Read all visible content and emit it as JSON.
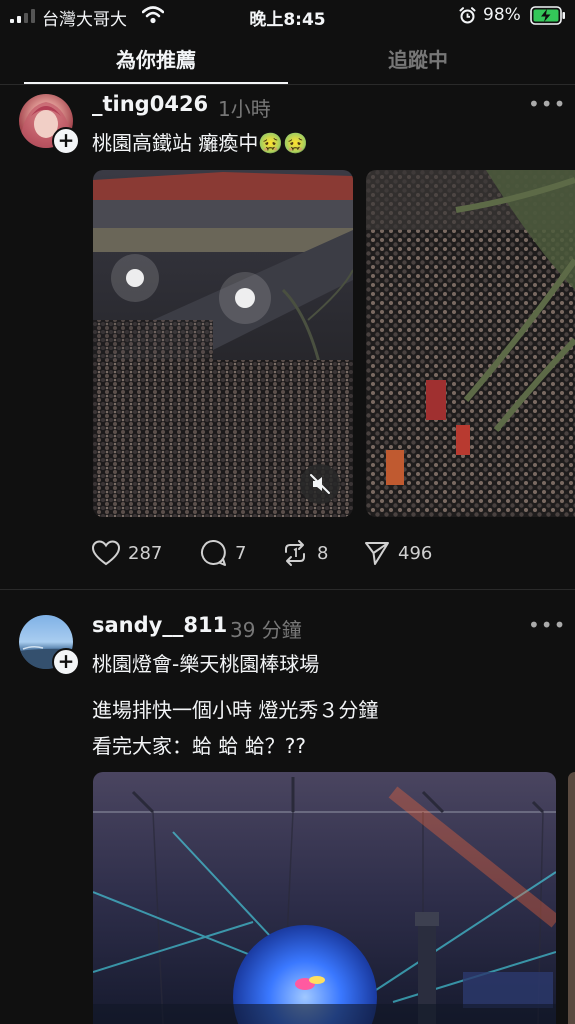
{
  "status_bar": {
    "carrier": "台灣大哥大",
    "time": "晚上8:45",
    "battery_percent": "98%",
    "icons": [
      "signal-icon",
      "wifi-icon",
      "alarm-icon",
      "battery-charging-icon"
    ]
  },
  "tabs": [
    {
      "label": "為你推薦",
      "active": true
    },
    {
      "label": "追蹤中",
      "active": false
    }
  ],
  "posts": [
    {
      "username": "_ting0426",
      "time": "1小時",
      "text": "桃園高鐵站 癱瘓中🤢🤢",
      "stats": {
        "likes": "287",
        "comments": "7",
        "reposts": "8",
        "shares": "496"
      }
    },
    {
      "username": "sandy__811",
      "time": "39 分鐘",
      "text_lines": [
        "桃園燈會-樂天桃園棒球場",
        "進場排快一個小時 燈光秀３分鐘",
        "看完大家：蛤 蛤 蛤？??"
      ]
    }
  ],
  "colors": {
    "background": "#101010",
    "text": "#f3f5f7",
    "muted": "#777777",
    "battery_green": "#34c759"
  }
}
